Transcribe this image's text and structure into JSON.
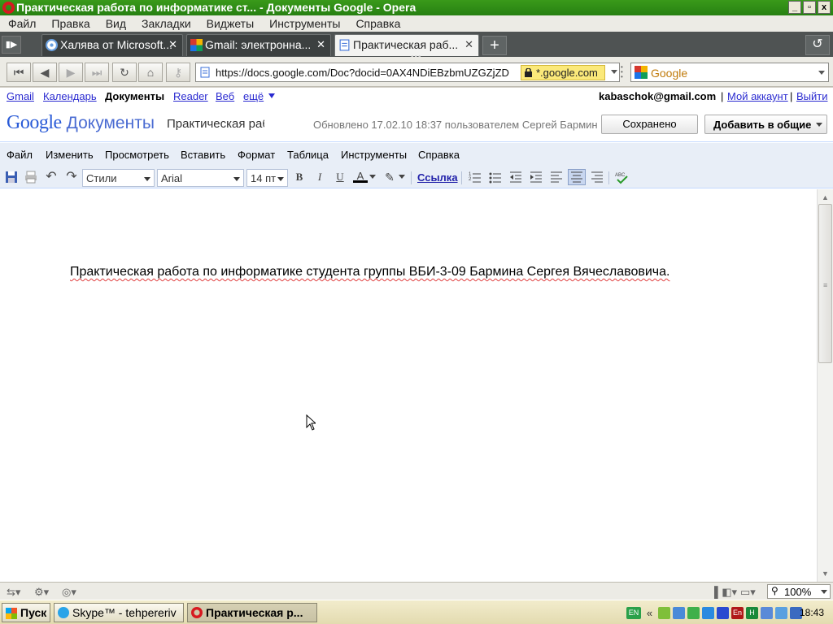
{
  "window": {
    "title": "Практическая работа по информатике ст... - Документы Google - Opera",
    "buttons": [
      "_",
      "▫",
      "x"
    ]
  },
  "browser_menu": [
    "Файл",
    "Правка",
    "Вид",
    "Закладки",
    "Виджеты",
    "Инструменты",
    "Справка"
  ],
  "tabs": [
    {
      "label": "Халява от Microsoft...",
      "active": false
    },
    {
      "label": "Gmail: электронна...",
      "active": false
    },
    {
      "label": "Практическая раб...",
      "active": true
    }
  ],
  "address": {
    "url": "https://docs.google.com/Doc?docid=0AX4NDiEBzbmUZGZjZD",
    "secure_domain": "*.google.com"
  },
  "search": {
    "engine": "Google"
  },
  "google_bar": {
    "links": [
      "Gmail",
      "Календарь",
      "Документы",
      "Reader",
      "Веб",
      "ещё"
    ],
    "email": "kabaschok@gmail.com",
    "separator": "|",
    "account": "Мой аккаунт",
    "logout": "Выйти"
  },
  "doc_header": {
    "logo_google": "Google",
    "logo_docs": "Документы",
    "doc_title": "Практическая раб",
    "updated": "Обновлено 17.02.10 18:37 пользователем Сергей Бармин",
    "saved_label": "Сохранено",
    "share_label": "Добавить в общие"
  },
  "doc_menu": [
    "Файл",
    "Изменить",
    "Просмотреть",
    "Вставить",
    "Формат",
    "Таблица",
    "Инструменты",
    "Справка"
  ],
  "toolbar": {
    "style": "Стили",
    "font": "Arial",
    "size": "14 пт",
    "link": "Ссылка",
    "bold": "B",
    "italic": "I",
    "underline": "U",
    "text_color": "A"
  },
  "document": {
    "text": "Практическая работа по информатике студента группы ВБИ-3-09 Бармина Сергея Вячеславовича."
  },
  "statusbar": {
    "zoom": "100%"
  },
  "taskbar": {
    "start": "Пуск",
    "tasks": [
      {
        "label": "Skype™ - tehpereriv"
      },
      {
        "label": "Практическая р..."
      }
    ],
    "lang": "EN",
    "time": "18:43"
  }
}
